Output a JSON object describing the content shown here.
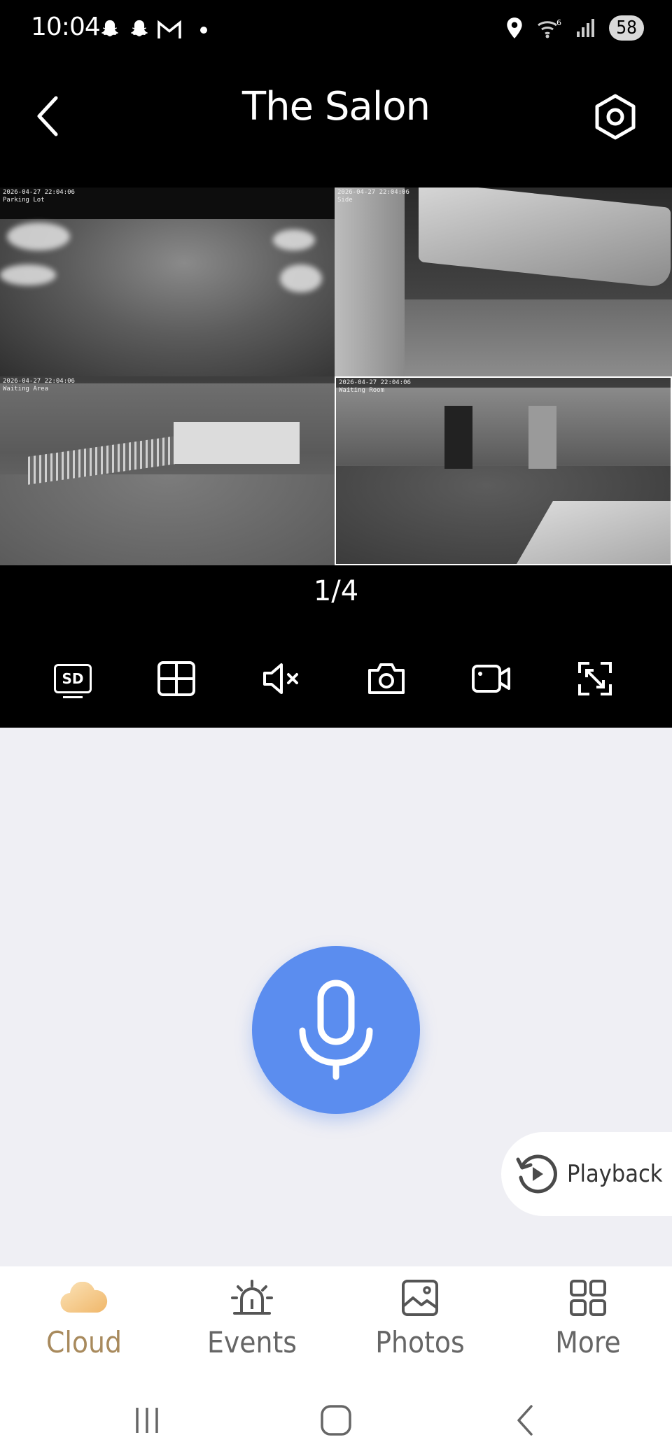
{
  "status_bar": {
    "time": "10:04",
    "battery": "58",
    "left_icons": [
      "snapchat-icon",
      "snapchat-icon",
      "gmail-icon",
      "notification-dot"
    ],
    "right_icons": [
      "location-icon",
      "wifi-6-icon",
      "signal-icon",
      "battery-icon"
    ]
  },
  "header": {
    "title": "The Salon",
    "back_icon": "chevron-left-icon",
    "settings_icon": "hexagon-settings-icon"
  },
  "cameras": [
    {
      "label": "2026-04-27 22:04:06\nParking Lot"
    },
    {
      "label": "2026-04-27 22:04:06\nSide"
    },
    {
      "label": "2026-04-27 22:04:06\nWaiting Area"
    },
    {
      "label": "2026-04-27 22:04:06\nWaiting Room"
    }
  ],
  "page_indicator": "1/4",
  "toolbar": {
    "sd_label": "SD",
    "icons": [
      "sd-quality-icon",
      "grid-layout-icon",
      "mute-icon",
      "camera-snapshot-icon",
      "video-record-icon",
      "fullscreen-icon"
    ]
  },
  "content": {
    "mic_icon": "microphone-icon",
    "playback_label": "Playback"
  },
  "bottom_nav": {
    "items": [
      {
        "label": "Cloud",
        "icon": "cloud-icon",
        "active": true
      },
      {
        "label": "Events",
        "icon": "alarm-icon",
        "active": false
      },
      {
        "label": "Photos",
        "icon": "photo-icon",
        "active": false
      },
      {
        "label": "More",
        "icon": "grid-more-icon",
        "active": false
      }
    ]
  },
  "colors": {
    "accent": "#5b8def",
    "active_nav": "#a88a5d",
    "background": "#efeff4"
  }
}
